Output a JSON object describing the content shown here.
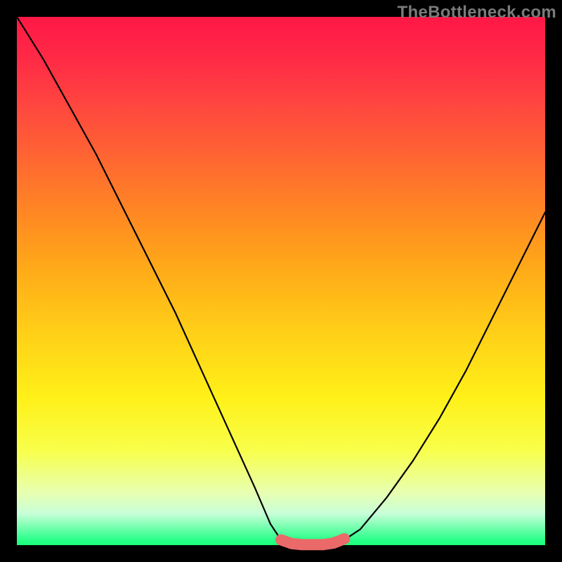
{
  "watermark": "TheBottleneck.com",
  "chart_data": {
    "type": "line",
    "title": "",
    "xlabel": "",
    "ylabel": "",
    "xlim": [
      0,
      100
    ],
    "ylim": [
      0,
      100
    ],
    "grid": false,
    "legend": false,
    "series": [
      {
        "name": "left-curve",
        "color": "#000000",
        "x": [
          0,
          5,
          10,
          15,
          20,
          25,
          30,
          35,
          40,
          45,
          48,
          50
        ],
        "y": [
          100,
          92,
          83,
          74,
          64,
          54,
          44,
          33,
          22,
          11,
          4,
          1
        ]
      },
      {
        "name": "right-curve",
        "color": "#000000",
        "x": [
          62,
          65,
          70,
          75,
          80,
          85,
          90,
          95,
          100
        ],
        "y": [
          1,
          3,
          9,
          16,
          24,
          33,
          43,
          53,
          63
        ]
      },
      {
        "name": "valley-highlight",
        "color": "#ea6a6a",
        "x": [
          50,
          52,
          54,
          56,
          58,
          60,
          62
        ],
        "y": [
          1,
          0.3,
          0.1,
          0.1,
          0.1,
          0.4,
          1.2
        ]
      }
    ]
  }
}
